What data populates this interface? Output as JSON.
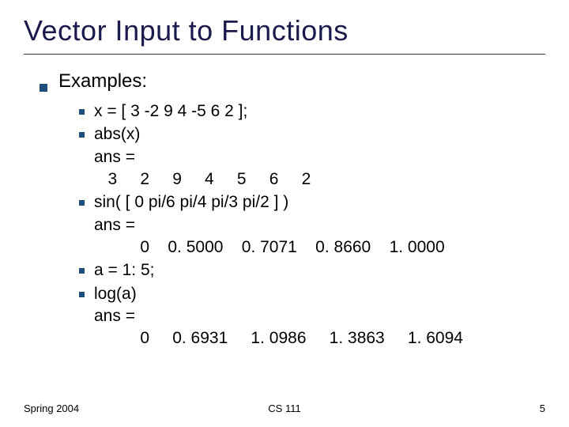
{
  "title": "Vector Input to Functions",
  "heading": "Examples:",
  "items": [
    {
      "text": "x = [ 3 -2 9 4 -5 6 2 ];"
    },
    {
      "text": "abs(x)\nans =\n   3     2     9     4     5     6     2"
    },
    {
      "text": "sin( [ 0 pi/6 pi/4 pi/3 pi/2 ] )\nans =\n          0    0. 5000    0. 7071    0. 8660    1. 0000"
    },
    {
      "text": "a = 1: 5;"
    },
    {
      "text": "log(a)\nans =\n          0     0. 6931     1. 0986     1. 3863     1. 6094"
    }
  ],
  "footer": {
    "left": "Spring 2004",
    "center": "CS 111",
    "right": "5"
  }
}
